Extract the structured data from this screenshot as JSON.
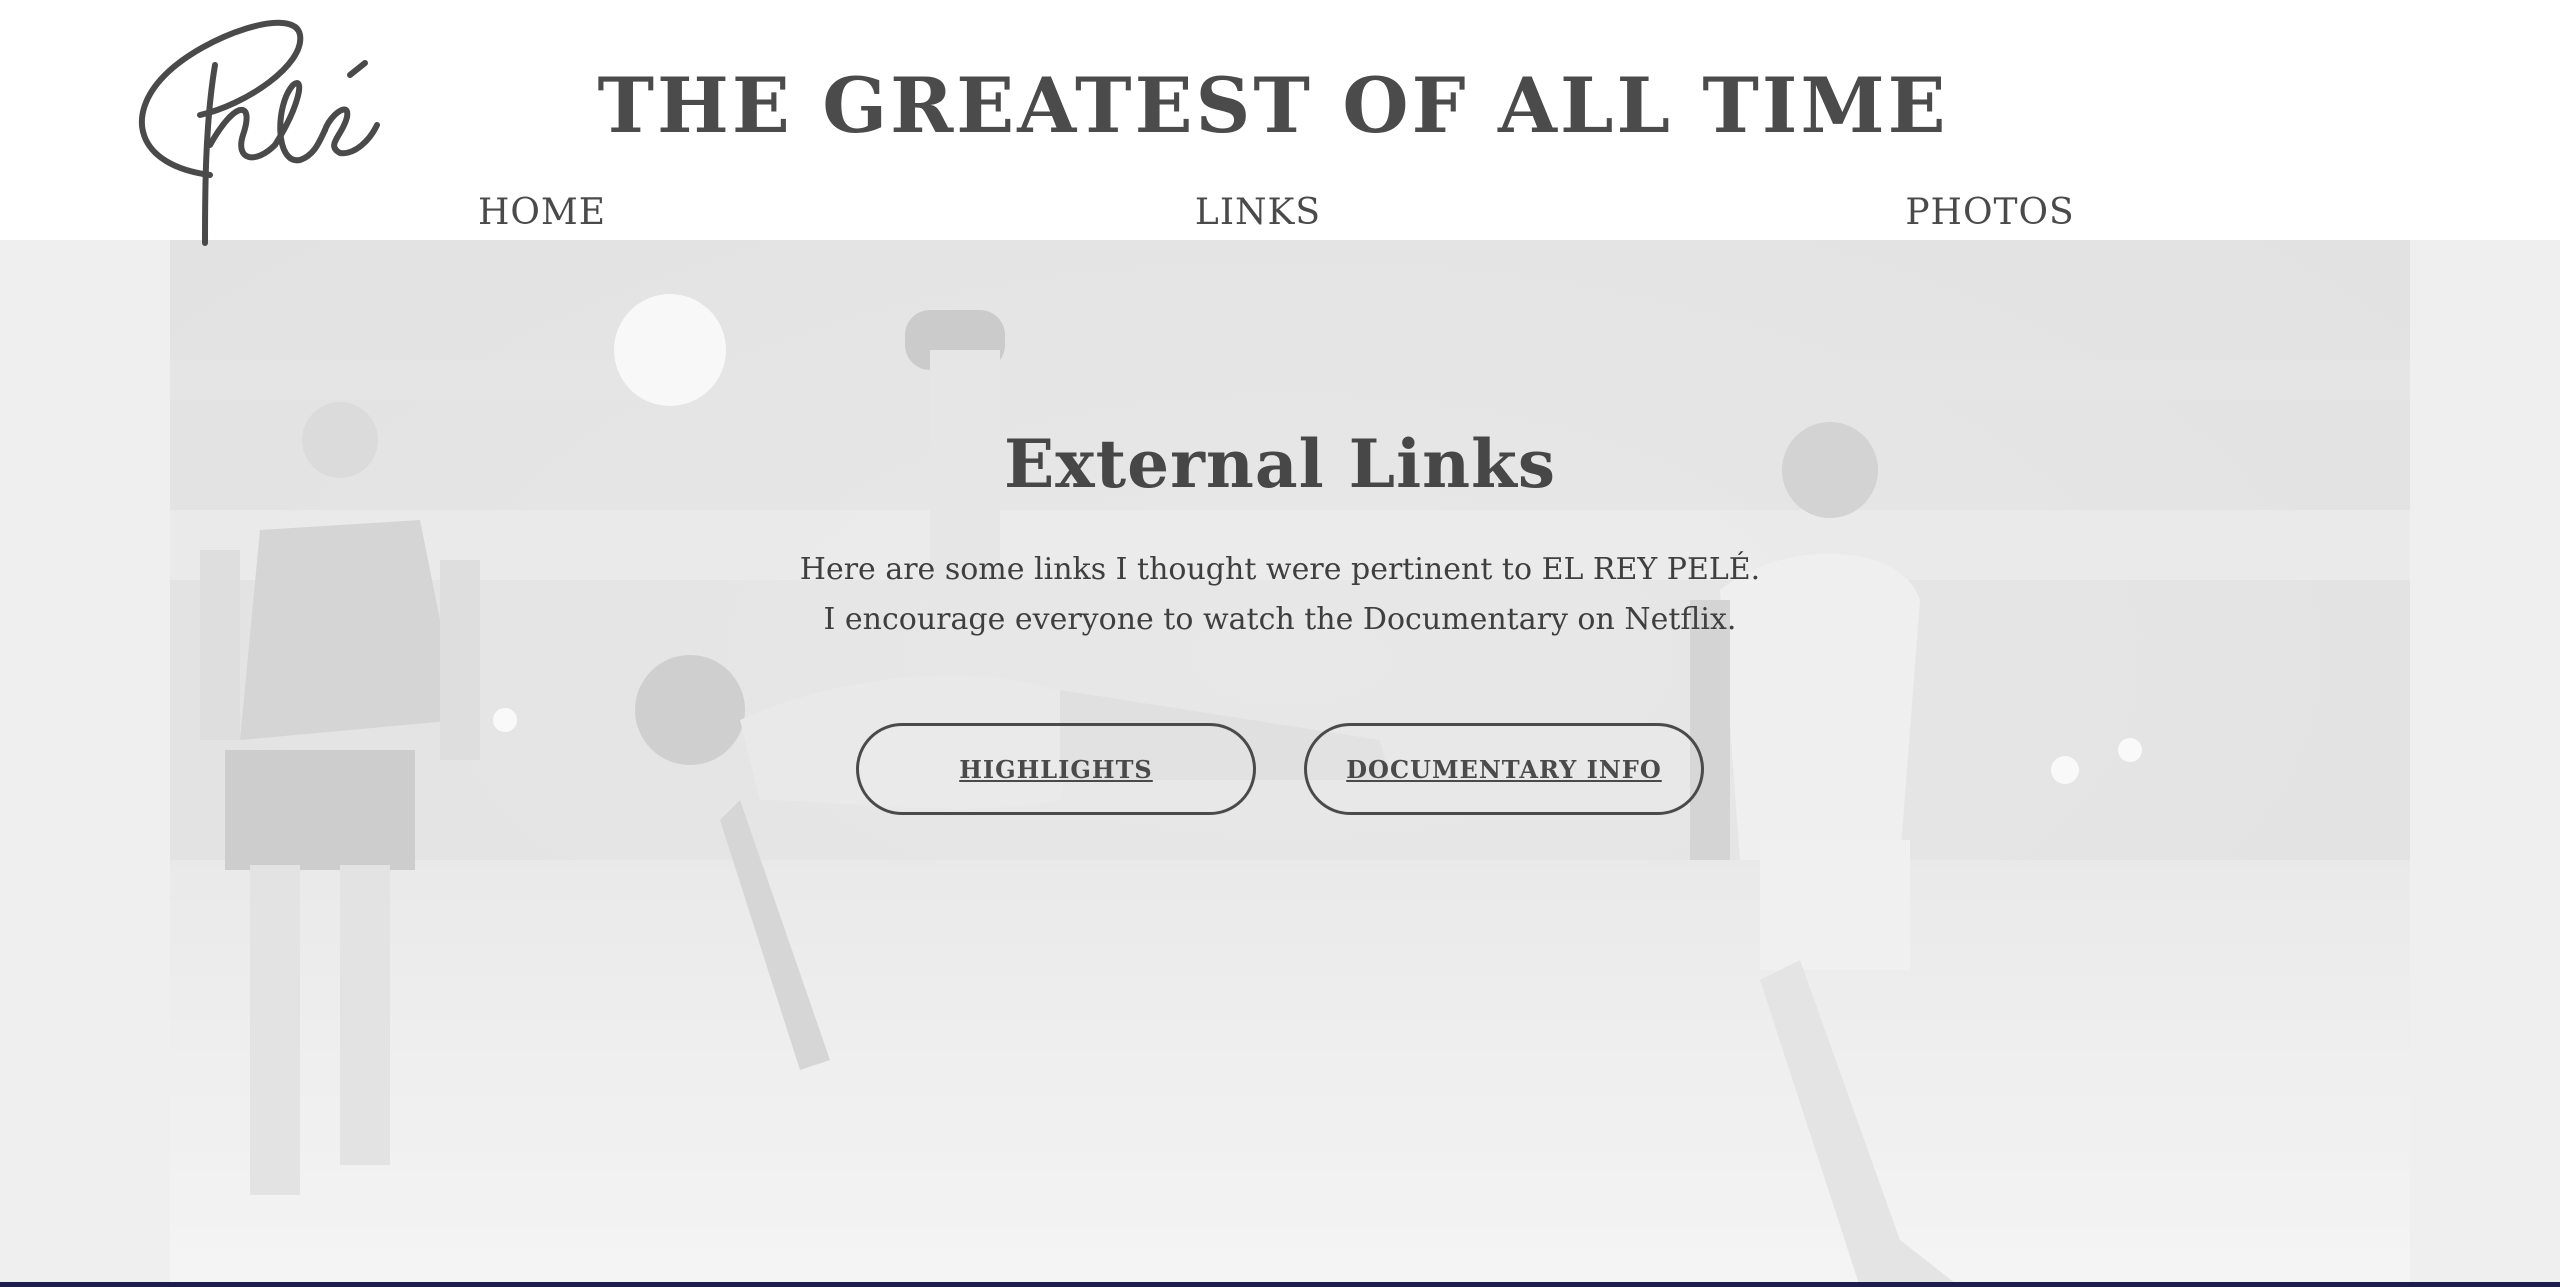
{
  "header": {
    "logo_text": "Pelé",
    "title": "THE GREATEST OF ALL TIME"
  },
  "nav": {
    "items": [
      {
        "label": "HOME"
      },
      {
        "label": "LINKS"
      },
      {
        "label": "PHOTOS"
      }
    ]
  },
  "main": {
    "heading": "External Links",
    "intro_lines": [
      "Here are some links I thought were pertinent to EL REY PELÉ.",
      "I encourage everyone to watch the Documentary on Netflix."
    ],
    "buttons": [
      {
        "label": "HIGHLIGHTS"
      },
      {
        "label": "DOCUMENTARY INFO"
      }
    ]
  },
  "colors": {
    "text": "#4a4a4a",
    "hero_background": "#e9e9e9",
    "page_background": "#ffffff"
  }
}
